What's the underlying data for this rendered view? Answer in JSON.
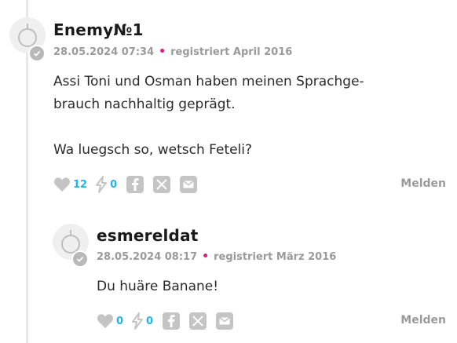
{
  "comments": [
    {
      "username": "Enemy№1",
      "timestamp": "28.05.2024 07:34",
      "registered": "registriert April 2016",
      "text": "Assi Toni und Osman haben meinen Sprachge-\nbrauch nachhaltig geprägt.\n\nWa luegsch so, wetsch Feteli?",
      "likes": "12",
      "bolts": "0",
      "report_label": "Melden"
    },
    {
      "username": "esmereldat",
      "timestamp": "28.05.2024 08:17",
      "registered": "registriert März 2016",
      "text": "Du huäre Banane!",
      "likes": "0",
      "bolts": "0",
      "report_label": "Melden"
    }
  ],
  "icons": {
    "heart": "heart-icon",
    "bolt": "bolt-icon",
    "facebook": "facebook-icon",
    "x": "x-icon",
    "mail": "mail-icon",
    "verified": "verified-check-icon",
    "avatar": "avatar-placeholder-icon"
  },
  "colors": {
    "accent_count": "#1fb5ea",
    "meta_dot": "#e8197d",
    "icon_grey": "#c4c4c4"
  },
  "separator": "•"
}
